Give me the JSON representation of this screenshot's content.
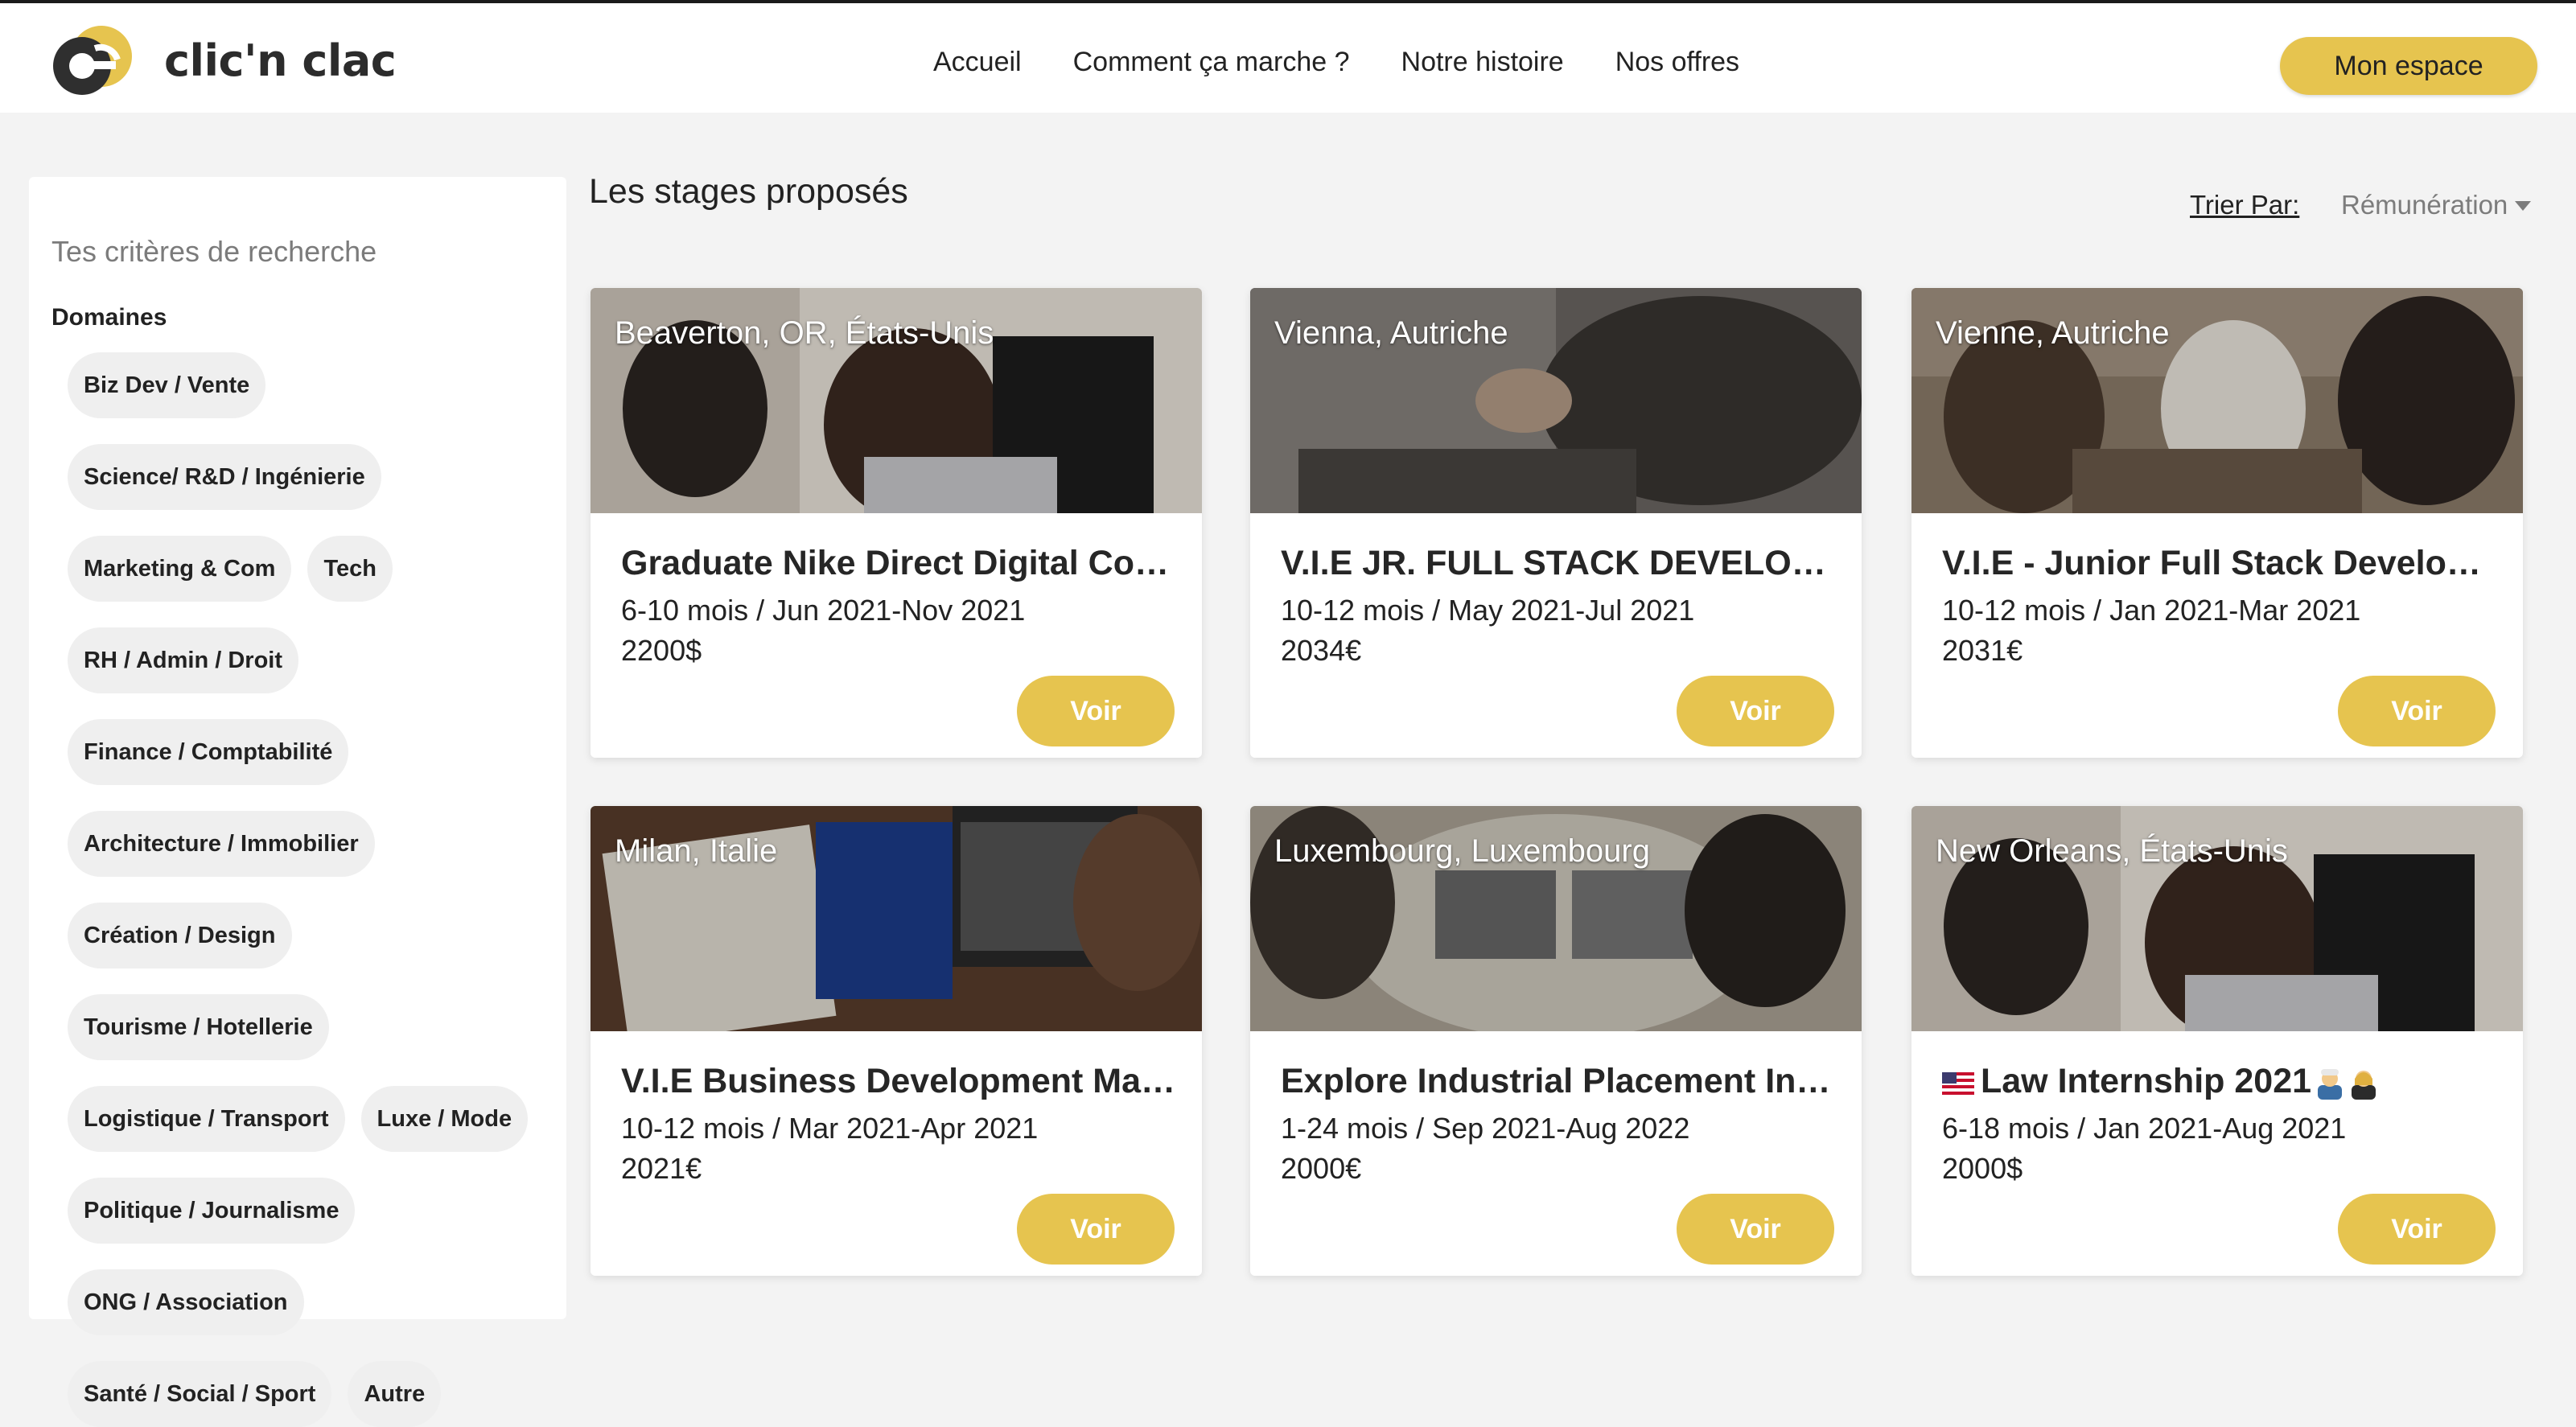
{
  "header": {
    "brand": "clic'n clac",
    "nav": [
      "Accueil",
      "Comment ça marche ?",
      "Notre histoire",
      "Nos offres"
    ],
    "account_button": "Mon espace"
  },
  "sidebar": {
    "title": "Tes critères de recherche",
    "domains_label": "Domaines",
    "domains": [
      "Biz Dev / Vente",
      "Science/ R&D / Ingénierie",
      "Marketing & Com",
      "Tech",
      "RH / Admin / Droit",
      "Finance / Comptabilité",
      "Architecture / Immobilier",
      "Création / Design",
      "Tourisme / Hotellerie",
      "Logistique / Transport",
      "Luxe / Mode",
      "Politique / Journalisme",
      "ONG / Association",
      "Santé / Social / Sport",
      "Autre"
    ]
  },
  "main": {
    "title": "Les stages proposés",
    "sort_label": "Trier Par:",
    "sort_value": "Rémunération",
    "cards": [
      {
        "location": "Beaverton, OR, États-Unis",
        "title": "Graduate Nike Direct Digital Com...",
        "duration": "6-10 mois / Jun 2021-Nov 2021",
        "salary": "2200$",
        "button": "Voir"
      },
      {
        "location": "Vienna, Autriche",
        "title": "V.I.E JR. FULL STACK DEVELOPER HF",
        "duration": "10-12 mois / May 2021-Jul 2021",
        "salary": "2034€",
        "button": "Voir"
      },
      {
        "location": "Vienne, Autriche",
        "title": "V.I.E - Junior Full Stack Developer",
        "duration": "10-12 mois / Jan 2021-Mar 2021",
        "salary": "2031€",
        "button": "Voir"
      },
      {
        "location": "Milan, Italie",
        "title": "V.I.E Business Development Mana...",
        "duration": "10-12 mois / Mar 2021-Apr 2021",
        "salary": "2021€",
        "button": "Voir"
      },
      {
        "location": "Luxembourg, Luxembourg",
        "title": "Explore Industrial Placement Inte...",
        "duration": "1-24 mois / Sep 2021-Aug 2022",
        "salary": "2000€",
        "button": "Voir"
      },
      {
        "location": "New Orleans, États-Unis",
        "title": "Law Internship 2021",
        "duration": "6-18 mois / Jan 2021-Aug 2021",
        "salary": "2000$",
        "button": "Voir"
      }
    ]
  },
  "colors": {
    "accent": "#e6c44f",
    "background": "#f3f3f3",
    "card": "#ffffff"
  }
}
